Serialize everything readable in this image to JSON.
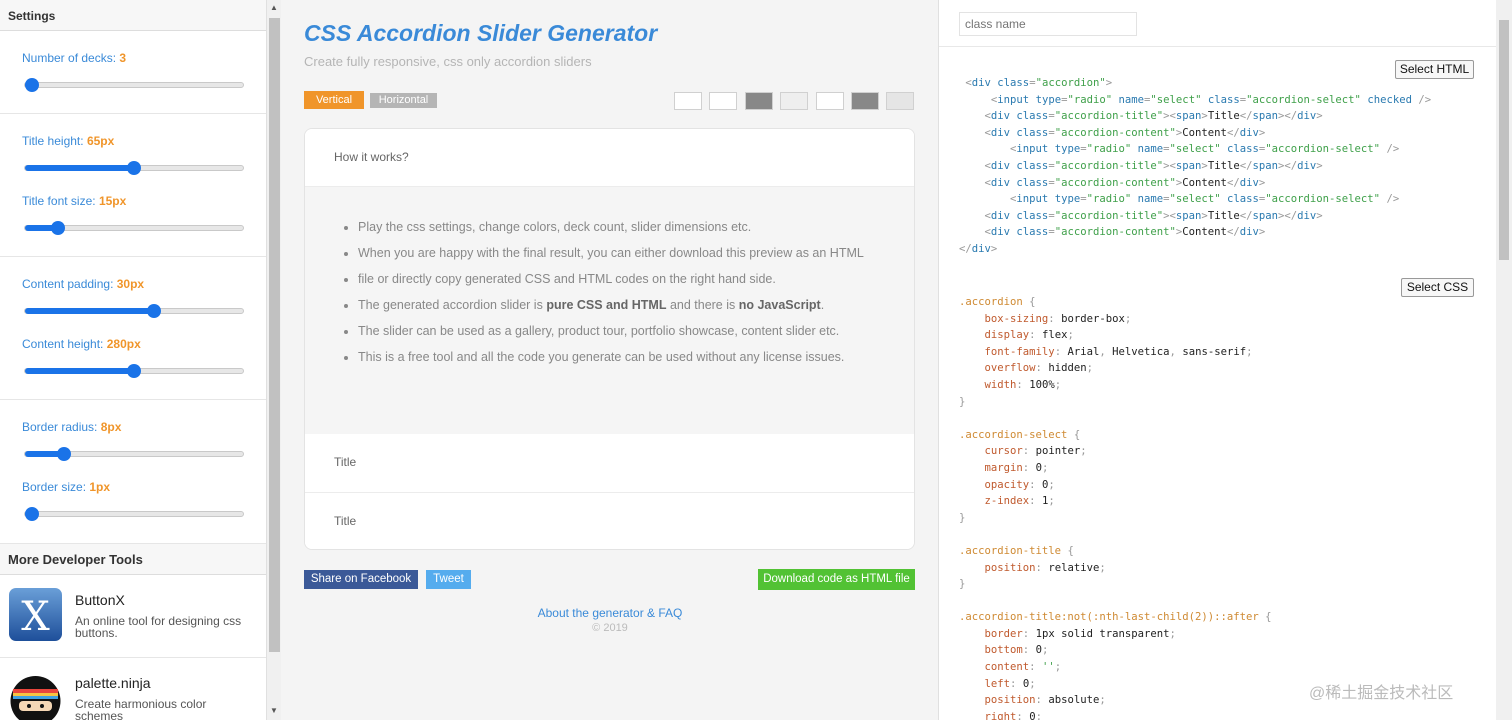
{
  "sidebar": {
    "header": "Settings",
    "sliders": [
      {
        "label": "Number of decks:",
        "value": "3",
        "fraction": 0.03
      },
      {
        "label": "Title height:",
        "value": "65px",
        "fraction": 0.5
      },
      {
        "label": "Title font size:",
        "value": "15px",
        "fraction": 0.15
      },
      {
        "label": "Content padding:",
        "value": "30px",
        "fraction": 0.59
      },
      {
        "label": "Content height:",
        "value": "280px",
        "fraction": 0.5
      },
      {
        "label": "Border radius:",
        "value": "8px",
        "fraction": 0.18
      },
      {
        "label": "Border size:",
        "value": "1px",
        "fraction": 0.03
      }
    ],
    "more_header": "More Developer Tools",
    "tools": [
      {
        "name": "ButtonX",
        "desc": "An online tool for designing css buttons.",
        "icon": "buttonx-logo-icon"
      },
      {
        "name": "palette.ninja",
        "desc": "Create harmonious color schemes",
        "icon": "ninja-logo-icon"
      }
    ]
  },
  "main": {
    "title": "CSS Accordion Slider Generator",
    "subtitle": "Create fully responsive, css only accordion sliders",
    "vertical_label": "Vertical",
    "horizontal_label": "Horizontal",
    "swatch_colors": [
      "#ffffff",
      "#ffffff",
      "#888888",
      "#eeeeee",
      "#ffffff",
      "#888888",
      "#e5e5e5"
    ],
    "accordion": {
      "title1": "How it works?",
      "bullets": [
        {
          "pre": "Play the css settings, change colors, deck count, slider dimensions etc.",
          "b1": "",
          "mid": "",
          "b2": "",
          "post": ""
        },
        {
          "pre": "When you are happy with the final result, you can either download this preview as an HTML",
          "b1": "",
          "mid": "",
          "b2": "",
          "post": ""
        },
        {
          "pre": "file or directly copy generated CSS and HTML codes on the right hand side.",
          "b1": "",
          "mid": "",
          "b2": "",
          "post": ""
        },
        {
          "pre": "The generated accordion slider is ",
          "b1": "pure CSS and HTML",
          "mid": " and there is ",
          "b2": "no JavaScript",
          "post": "."
        },
        {
          "pre": "The slider can be used as a gallery, product tour, portfolio showcase, content slider etc.",
          "b1": "",
          "mid": "",
          "b2": "",
          "post": ""
        },
        {
          "pre": "This is a free tool and all the code you generate can be used without any license issues.",
          "b1": "",
          "mid": "",
          "b2": "",
          "post": ""
        }
      ],
      "title2": "Title",
      "title3": "Title"
    },
    "facebook_label": "Share on Facebook",
    "tweet_label": "Tweet",
    "download_label": "Download code as HTML file",
    "about_link": "About the generator & FAQ",
    "copyright": "© 2019"
  },
  "code": {
    "class_placeholder": "class name",
    "select_html_label": "Select HTML",
    "select_css_label": "Select CSS"
  },
  "watermark": "@稀土掘金技术社区"
}
